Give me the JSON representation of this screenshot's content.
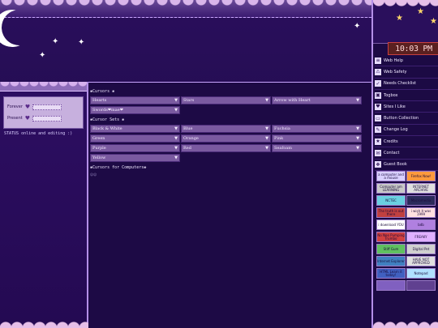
{
  "left": {
    "status_rows": [
      {
        "label": "Forever"
      },
      {
        "label": "Present"
      }
    ],
    "status_text": "STATUS online and editing :)"
  },
  "main": {
    "cursors_heading": "❀Cursors ❀",
    "cursors": [
      {
        "label": "Hearts"
      },
      {
        "label": "Stars"
      },
      {
        "label": "Arrow with Heart"
      },
      {
        "label": "Swords❤mae❤"
      }
    ],
    "cursor_sets_heading": "❀Cursor Sets ❀",
    "cursor_sets": [
      {
        "label": "Black & White"
      },
      {
        "label": "Blue"
      },
      {
        "label": "Fuchsia"
      },
      {
        "label": "Green"
      },
      {
        "label": "Orange"
      },
      {
        "label": "Pink"
      },
      {
        "label": "Purple"
      },
      {
        "label": "Red"
      },
      {
        "label": "Seafoam"
      },
      {
        "label": "Yellow"
      }
    ],
    "computers_heading": "❀Cursors for Computers❀",
    "computers_note": "☺☺"
  },
  "sidebar": {
    "clock": "10:03 PM",
    "nav": [
      {
        "label": "Web Help",
        "icon": "list-icon"
      },
      {
        "label": "Web Safety",
        "icon": "warning-icon"
      },
      {
        "label": "Needs Checklist",
        "icon": "checklist-icon"
      },
      {
        "label": "Togbox",
        "icon": "box-icon"
      },
      {
        "label": "Sites I Like",
        "icon": "heart-icon"
      },
      {
        "label": "Button Collection",
        "icon": "button-icon"
      },
      {
        "label": "Change Log",
        "icon": "log-icon"
      },
      {
        "label": "Credits",
        "icon": "star-icon"
      },
      {
        "label": "Contact",
        "icon": "mail-icon"
      },
      {
        "label": "Guest Book",
        "icon": "book-icon"
      }
    ],
    "banners": [
      {
        "text": "a computer and a mouse",
        "color": "#d9d0ff"
      },
      {
        "text": "Firefox Now!",
        "color": "#ff9a3c"
      },
      {
        "text": "Computer am LEARNING",
        "color": "#c8c8c8"
      },
      {
        "text": "INTERNET ARCHIVE",
        "color": "#e0e0e0"
      },
      {
        "text": "NCTEC",
        "color": "#6ad0e0"
      },
      {
        "text": "Macromedia",
        "color": "#2a2a5a"
      },
      {
        "text": "The truth is out there",
        "color": "#c04040"
      },
      {
        "text": "i wish it was 1999",
        "color": "#ffe0e0"
      },
      {
        "text": "i download YOU",
        "color": "#ffffff"
      },
      {
        "text": "bdb",
        "color": "#b080e0"
      },
      {
        "text": "No Neo Pumping Trumbo",
        "color": "#d04040"
      },
      {
        "text": "FREAKY",
        "color": "#e0b0ff"
      },
      {
        "text": "Stiff Gum",
        "color": "#60c060"
      },
      {
        "text": "Digital Pet",
        "color": "#d0d0d0"
      },
      {
        "text": "Internet Explorer",
        "color": "#4080c0"
      },
      {
        "text": "HAVE NOT APPROVED",
        "color": "#e0e0e0"
      },
      {
        "text": "HTML Learn it today!",
        "color": "#4060c0"
      },
      {
        "text": "Notepad",
        "color": "#b0e0ff"
      },
      {
        "text": "",
        "color": "#8060c0"
      },
      {
        "text": "",
        "color": "#604090"
      }
    ]
  }
}
